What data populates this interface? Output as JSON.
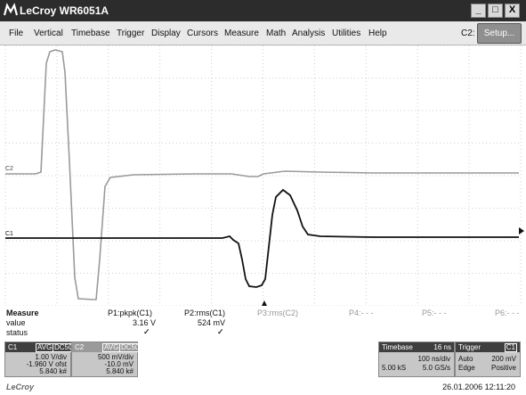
{
  "window": {
    "title": "LeCroy WR6051A",
    "buttons": {
      "minimize": "_",
      "maximize": "□",
      "close": "X"
    }
  },
  "menu": {
    "items": [
      "File",
      "Vertical",
      "Timebase",
      "Trigger",
      "Display",
      "Cursors",
      "Measure",
      "Math",
      "Analysis",
      "Utilities",
      "Help"
    ],
    "channel_label": "C2:",
    "setup_label": "Setup..."
  },
  "graph": {
    "channel_markers": {
      "c2": "C2",
      "c1": "C1"
    },
    "colors": {
      "c1_trace": "#111111",
      "c2_trace": "#9a9a9a",
      "grid": "#cfcfcf"
    }
  },
  "measure": {
    "title": "Measure",
    "row_labels": {
      "value": "value",
      "status": "status"
    },
    "params": [
      {
        "name": "P1:pkpk(C1)",
        "value": "3.16 V",
        "status": "✓"
      },
      {
        "name": "P2:rms(C1)",
        "value": "524 mV",
        "status": "✓"
      },
      {
        "name": "P3:rms(C2)",
        "value": "",
        "status": ""
      },
      {
        "name": "P4:- - -",
        "value": "",
        "status": ""
      },
      {
        "name": "P5:- - -",
        "value": "",
        "status": ""
      },
      {
        "name": "P6:- - -",
        "value": "",
        "status": ""
      }
    ]
  },
  "channels": {
    "c1": {
      "name": "C1",
      "avg": "AVG",
      "coupling": "DC50",
      "vdiv": "1.00 V/div",
      "offset": "-1.960 V ofst",
      "count": "5.840 k#"
    },
    "c2": {
      "name": "C2",
      "avg": "AVG",
      "coupling": "DC50",
      "vdiv": "500 mV/div",
      "offset": "-10.0 mV",
      "count": "5.840 k#"
    }
  },
  "timebase": {
    "label": "Timebase",
    "delay": "16 ns",
    "tdiv": "100 ns/div",
    "samples": "5.00 kS",
    "rate": "5.0 GS/s"
  },
  "trigger": {
    "label": "Trigger",
    "source": "C1",
    "mode": "Auto",
    "level": "200 mV",
    "type": "Edge",
    "slope": "Positive"
  },
  "footer": {
    "brand": "LeCroy",
    "timestamp": "26.01.2006 12:11:20"
  }
}
